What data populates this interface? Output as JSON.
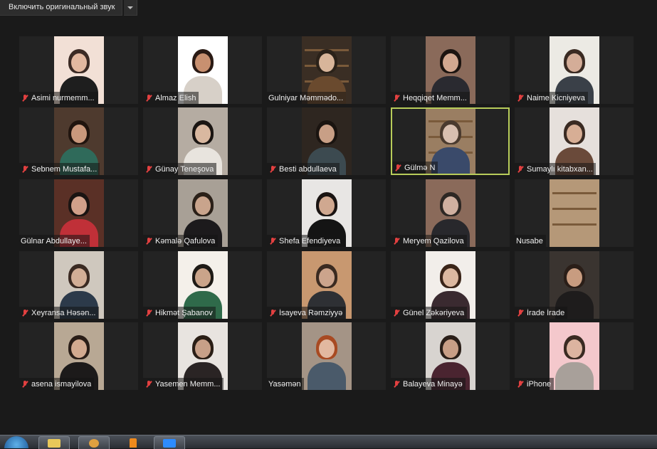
{
  "toolbar": {
    "audio_button_label": "Включить оригинальный звук"
  },
  "active_speaker_color": "#b8cc5a",
  "muted_icon": "mic-muted-icon",
  "participants": [
    {
      "name": "Asimi nurmemm...",
      "muted": true
    },
    {
      "name": "Almaz Elish",
      "muted": true
    },
    {
      "name": "Gulniyar Məmmədo...",
      "muted": false
    },
    {
      "name": "Heqqiqet Memm...",
      "muted": true
    },
    {
      "name": "Naime Kicniyeva",
      "muted": true
    },
    {
      "name": "Sebnem Mustafa...",
      "muted": true
    },
    {
      "name": "Günay Teneşova",
      "muted": true
    },
    {
      "name": "Besti abdullaeva",
      "muted": true
    },
    {
      "name": "Gülmə N",
      "muted": true,
      "active_speaker": true
    },
    {
      "name": "Sumaylı kitabxan...",
      "muted": true
    },
    {
      "name": "Gülnar Abdullaye...",
      "muted": false
    },
    {
      "name": "Kəmalə Qafulova",
      "muted": true
    },
    {
      "name": "Shefa Efendiyeva",
      "muted": true
    },
    {
      "name": "Meryem Qazilova",
      "muted": true
    },
    {
      "name": "Nusabe",
      "muted": false
    },
    {
      "name": "Xeyransa Həsən...",
      "muted": true
    },
    {
      "name": "Hikmət Şabanov",
      "muted": true
    },
    {
      "name": "İsayeva Rəmziyyə",
      "muted": true
    },
    {
      "name": "Günel Zəkəriyeva",
      "muted": true
    },
    {
      "name": "İrade İrade",
      "muted": true
    },
    {
      "name": "asena ismayilova",
      "muted": true
    },
    {
      "name": "Yasemen Memm...",
      "muted": true
    },
    {
      "name": "Yasəmən",
      "muted": false
    },
    {
      "name": "Balayeva Minayə",
      "muted": true
    },
    {
      "name": "iPhone",
      "muted": true
    }
  ],
  "taskbar": {
    "items": [
      "windows-start-icon",
      "file-explorer-icon",
      "media-player-icon",
      "vlc-icon",
      "zoom-icon"
    ]
  }
}
